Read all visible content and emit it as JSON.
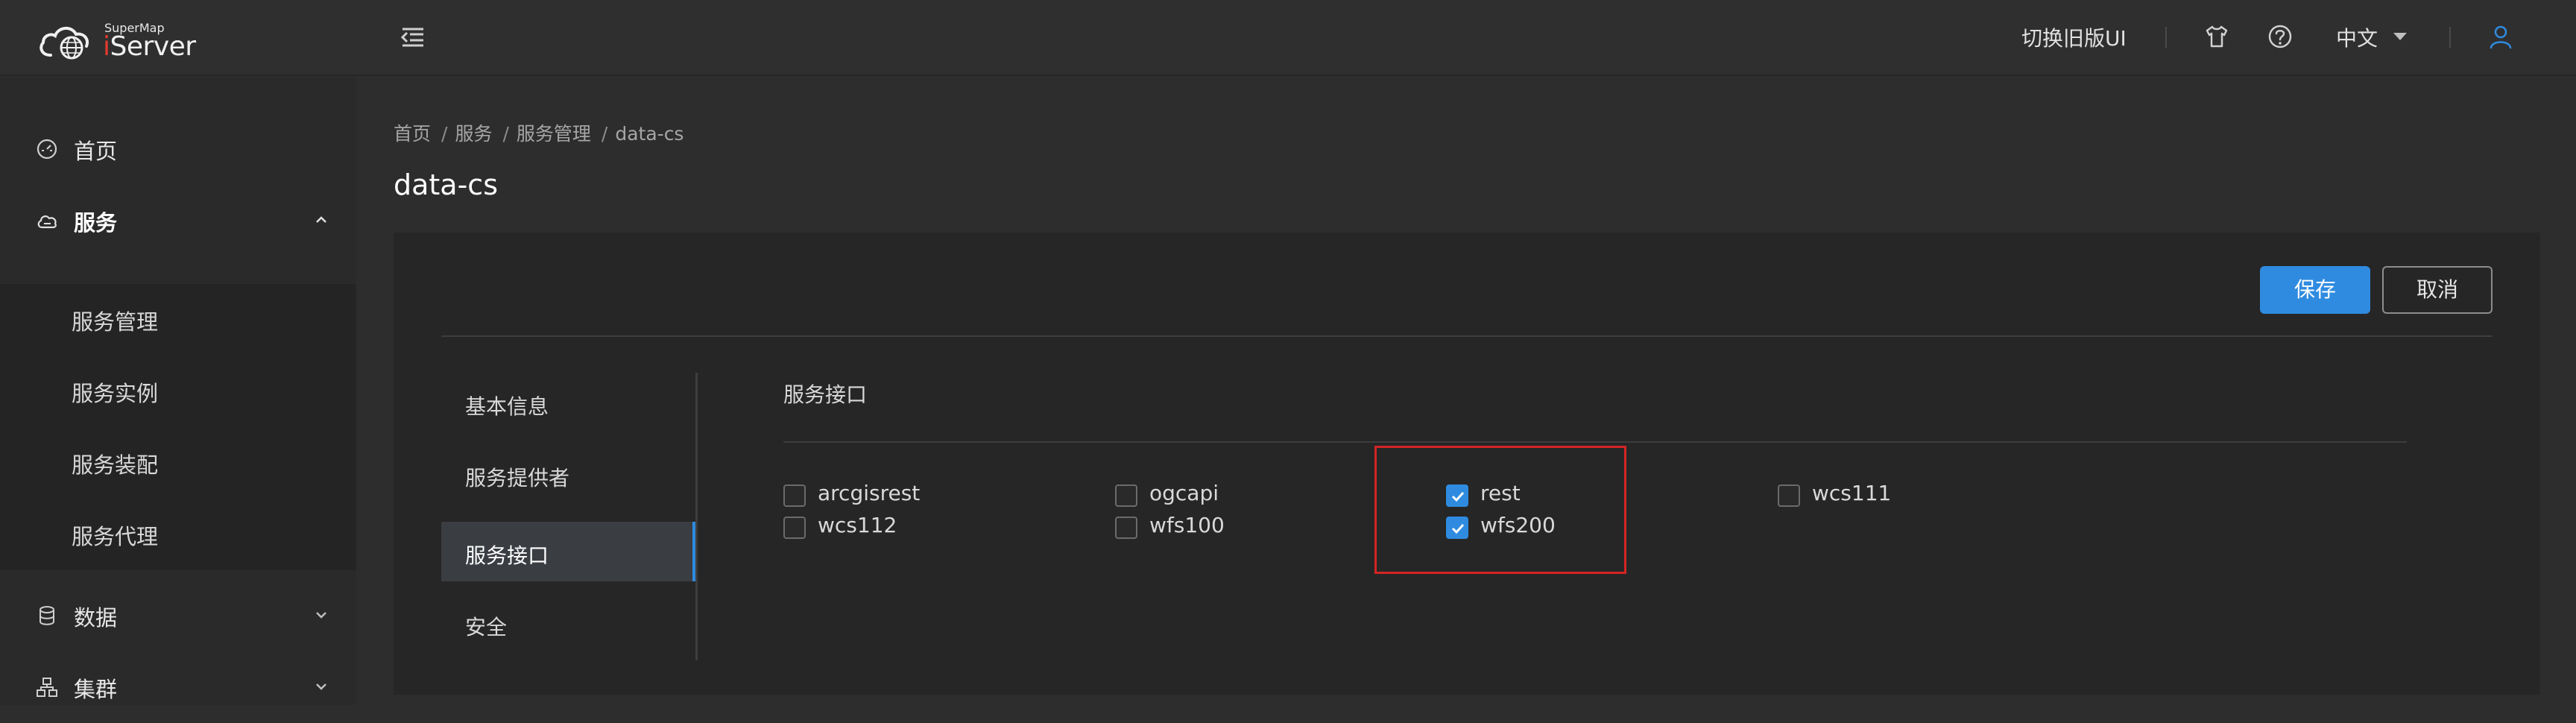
{
  "header": {
    "logo_small": "SuperMap",
    "logo_i": "i",
    "logo_main": "Server",
    "switch_old_ui": "切换旧版UI",
    "language": "中文",
    "icons": [
      "menu-fold-icon",
      "skin-icon",
      "help-icon",
      "user-icon"
    ]
  },
  "sidebar": {
    "items": [
      {
        "label": "首页",
        "icon": "dashboard-icon"
      },
      {
        "label": "服务",
        "icon": "cloud-icon",
        "expanded": true
      },
      {
        "label": "数据",
        "icon": "database-icon"
      },
      {
        "label": "集群",
        "icon": "cluster-icon"
      }
    ],
    "subitems": [
      {
        "label": "服务管理"
      },
      {
        "label": "服务实例"
      },
      {
        "label": "服务装配"
      },
      {
        "label": "服务代理"
      }
    ]
  },
  "breadcrumb": [
    "首页",
    "服务",
    "服务管理",
    "data-cs"
  ],
  "page_title": "data-cs",
  "buttons": {
    "save": "保存",
    "cancel": "取消"
  },
  "tabs": [
    {
      "label": "基本信息"
    },
    {
      "label": "服务提供者"
    },
    {
      "label": "服务接口",
      "active": true
    },
    {
      "label": "安全"
    }
  ],
  "section": {
    "title": "服务接口"
  },
  "interfaces": [
    {
      "label": "arcgisrest",
      "checked": false
    },
    {
      "label": "ogcapi",
      "checked": false
    },
    {
      "label": "rest",
      "checked": true
    },
    {
      "label": "wcs111",
      "checked": false
    },
    {
      "label": "wcs112",
      "checked": false
    },
    {
      "label": "wfs100",
      "checked": false
    },
    {
      "label": "wfs200",
      "checked": true
    }
  ],
  "colors": {
    "accent": "#2f8be0",
    "highlight": "#d42424",
    "logo_red": "#e23b2e"
  }
}
